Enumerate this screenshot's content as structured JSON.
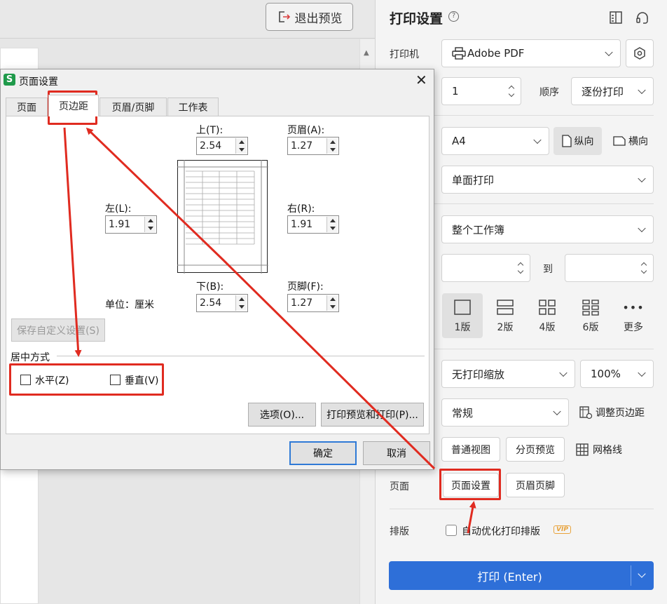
{
  "preview": {
    "exit_label": "退出预览"
  },
  "panel": {
    "title": "打印设置",
    "printer_label": "打印机",
    "printer_value": "Adobe PDF",
    "copies_value": "1",
    "order_label": "顺序",
    "order_value": "逐份打印",
    "paper_value": "A4",
    "portrait_label": "纵向",
    "landscape_label": "横向",
    "sides_value": "单面打印",
    "range_value": "整个工作簿",
    "to_label": "到",
    "layouts": [
      {
        "label": "1版"
      },
      {
        "label": "2版"
      },
      {
        "label": "4版"
      },
      {
        "label": "6版"
      },
      {
        "label": "更多"
      }
    ],
    "scale_value": "无打印缩放",
    "zoom_value": "100%",
    "margin_value": "常规",
    "adjust_margin_label": "调整页边距",
    "normal_view_label": "普通视图",
    "page_break_label": "分页预览",
    "gridlines_label": "网格线",
    "page_label": "页面",
    "page_setup_label": "页面设置",
    "header_footer_label": "页眉页脚",
    "layout_label": "排版",
    "auto_optimize_label": "自动优化打印排版",
    "vip_label": "VIP",
    "print_label": "打印 (Enter)"
  },
  "dialog": {
    "title": "页面设置",
    "app_icon_letter": "S",
    "tabs": [
      "页面",
      "页边距",
      "页眉/页脚",
      "工作表"
    ],
    "top_label": "上(T):",
    "top_value": "2.54",
    "header_label": "页眉(A):",
    "header_value": "1.27",
    "left_label": "左(L):",
    "left_value": "1.91",
    "right_label": "右(R):",
    "right_value": "1.91",
    "bottom_label": "下(B):",
    "bottom_value": "2.54",
    "footer_label": "页脚(F):",
    "footer_value": "1.27",
    "unit_label": "单位：厘米",
    "save_custom_label": "保存自定义设置(S)",
    "center_group_label": "居中方式",
    "horizontal_label": "水平(Z)",
    "vertical_label": "垂直(V)",
    "options_label": "选项(O)...",
    "print_preview_label": "打印预览和打印(P)...",
    "ok_label": "确定",
    "cancel_label": "取消"
  },
  "colors": {
    "accent": "#2e6fd8",
    "highlight": "#e02b20",
    "vip": "#e8a33c"
  }
}
